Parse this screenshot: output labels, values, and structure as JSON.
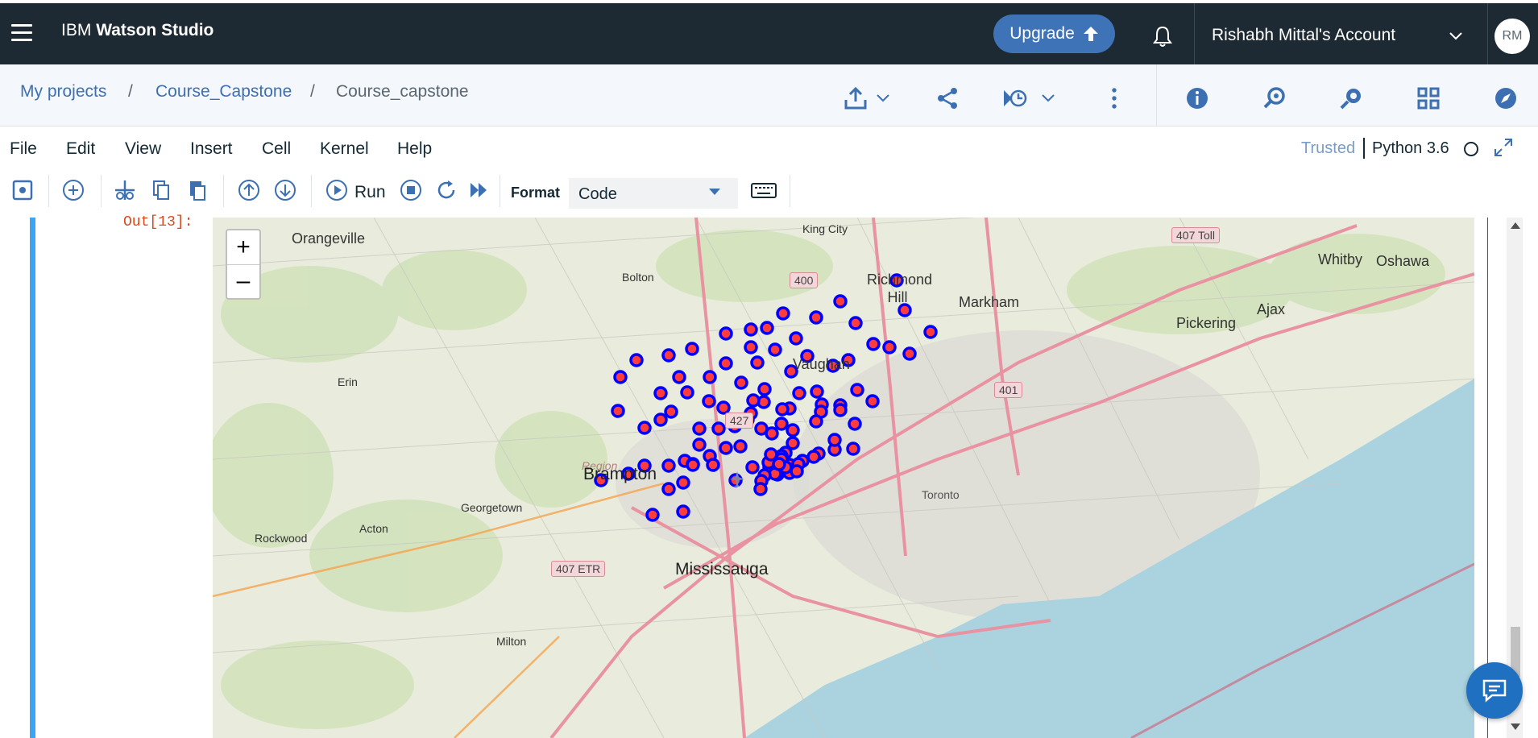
{
  "header": {
    "brand_prefix": "IBM",
    "brand_name": "Watson Studio",
    "upgrade_label": "Upgrade",
    "account_label": "Rishabh Mittal's Account",
    "avatar_initials": "RM",
    "icons": [
      "menu-icon",
      "arrow-up-icon",
      "bell-icon",
      "chevron-down-icon"
    ]
  },
  "breadcrumb": {
    "items": [
      "My projects",
      "Course_Capstone"
    ],
    "separator": "/",
    "current": "Course_capstone"
  },
  "toolbar_icons": [
    "export-icon",
    "share-icon",
    "version-history-icon",
    "overflow-icon",
    "info-icon",
    "find-resources-icon",
    "explore-icon",
    "assets-icon",
    "compass-icon"
  ],
  "menubar": {
    "items": [
      "File",
      "Edit",
      "View",
      "Insert",
      "Cell",
      "Kernel",
      "Help"
    ],
    "trusted": "Trusted",
    "kernel": "Python 3.6"
  },
  "notebook_toolbar": {
    "run_label": "Run",
    "format_label": "Format",
    "format_value": "Code"
  },
  "cell": {
    "out_prompt": "Out[13]:"
  },
  "map": {
    "zoom_in": "+",
    "zoom_out": "–",
    "labels": {
      "orangeville": "Orangeville",
      "king_city": "King City",
      "richmond_hill": "Richmond Hill",
      "markham": "Markham",
      "bolton": "Bolton",
      "vaughan": "Vaughan",
      "erin": "Erin",
      "region": "Region",
      "brampton": "Brampton",
      "georgetown": "Georgetown",
      "acton": "Acton",
      "rockwood": "Rockwood",
      "mississauga": "Mississauga",
      "milton": "Milton",
      "whitby": "Whitby",
      "oshawa": "Oshawa",
      "ajax": "Ajax",
      "pickering": "Pickering",
      "toronto": "Toronto"
    },
    "shields": {
      "h400": "400",
      "h427": "427",
      "h401": "401",
      "h407toll": "407 Toll",
      "h407etr": "407 ETR"
    },
    "marker_fill": "#ff3b3b",
    "marker_stroke": "#0000ff",
    "water_color": "#aad3df",
    "marker_count": 103
  },
  "colors": {
    "topbar": "#1e2a33",
    "upgrade": "#3f73b8",
    "link": "#3d70b2",
    "cell_bar": "#3da4f3",
    "chat": "#1f70c1"
  }
}
